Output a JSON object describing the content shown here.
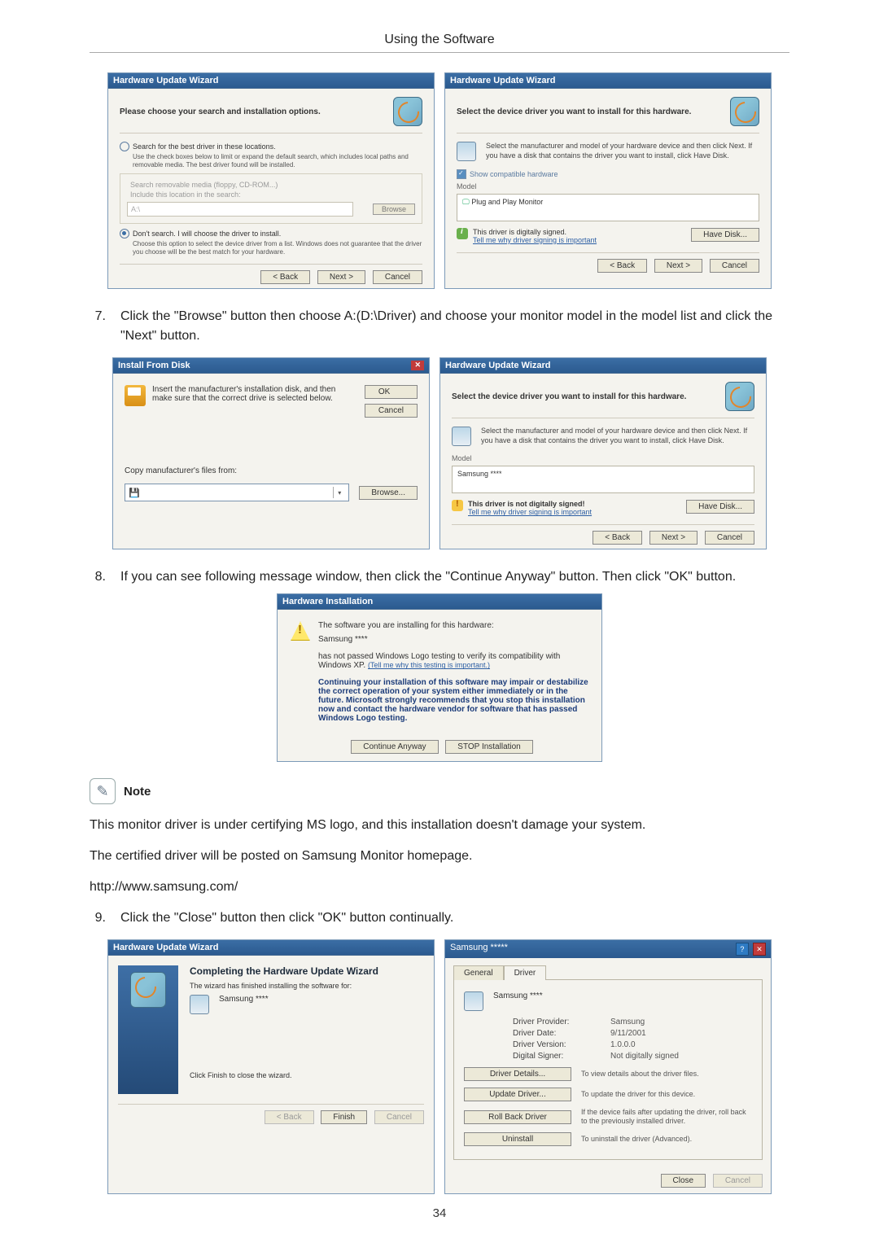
{
  "page_header": "Using the Software",
  "page_number": "34",
  "dialog1": {
    "title": "Hardware Update Wizard",
    "head": "Please choose your search and installation options.",
    "radio1": "Search for the best driver in these locations.",
    "radio1_sub": "Use the check boxes below to limit or expand the default search, which includes local paths and removable media. The best driver found will be installed.",
    "chk1": "Search removable media (floppy, CD-ROM...)",
    "chk2": "Include this location in the search:",
    "path_placeholder": "A:\\",
    "browse": "Browse",
    "radio2": "Don't search. I will choose the driver to install.",
    "radio2_sub": "Choose this option to select the device driver from a list. Windows does not guarantee that the driver you choose will be the best match for your hardware.",
    "back": "< Back",
    "next": "Next >",
    "cancel": "Cancel"
  },
  "dialog2": {
    "title": "Hardware Update Wizard",
    "head": "Select the device driver you want to install for this hardware.",
    "helper": "Select the manufacturer and model of your hardware device and then click Next. If you have a disk that contains the driver you want to install, click Have Disk.",
    "chk": "Show compatible hardware",
    "model_header": "Model",
    "model_value": "Plug and Play Monitor",
    "signed": "This driver is digitally signed.",
    "tell_me": "Tell me why driver signing is important",
    "have_disk": "Have Disk...",
    "back": "< Back",
    "next": "Next >",
    "cancel": "Cancel"
  },
  "step7": {
    "num": "7.",
    "text": "Click the \"Browse\" button then choose A:(D:\\Driver) and choose your monitor model in the model list and click the \"Next\" button."
  },
  "install_disk": {
    "title": "Install From Disk",
    "text": "Insert the manufacturer's installation disk, and then make sure that the correct drive is selected below.",
    "ok": "OK",
    "cancel": "Cancel",
    "copy_label": "Copy manufacturer's files from:",
    "browse": "Browse..."
  },
  "dialog2b": {
    "title": "Hardware Update Wizard",
    "head": "Select the device driver you want to install for this hardware.",
    "helper": "Select the manufacturer and model of your hardware device and then click Next. If you have a disk that contains the driver you want to install, click Have Disk.",
    "model_header": "Model",
    "model_value": "Samsung ****",
    "not_signed": "This driver is not digitally signed!",
    "tell_me": "Tell me why driver signing is important",
    "have_disk": "Have Disk...",
    "back": "< Back",
    "next": "Next >",
    "cancel": "Cancel"
  },
  "step8": {
    "num": "8.",
    "text": "If you can see following message window, then click the \"Continue Anyway\" button. Then click \"OK\" button."
  },
  "hw_install": {
    "title": "Hardware Installation",
    "line1": "The software you are installing for this hardware:",
    "device": "Samsung ****",
    "line2": "has not passed Windows Logo testing to verify its compatibility with Windows XP.",
    "tell_me": "(Tell me why this testing is important.)",
    "bold": "Continuing your installation of this software may impair or destabilize the correct operation of your system either immediately or in the future. Microsoft strongly recommends that you stop this installation now and contact the hardware vendor for software that has passed Windows Logo testing.",
    "continue": "Continue Anyway",
    "stop": "STOP Installation"
  },
  "note_label": "Note",
  "note_p1": "This monitor driver is under certifying MS logo, and this installation doesn't damage your system.",
  "note_p2": "The certified driver will be posted on Samsung Monitor homepage.",
  "note_url": "http://www.samsung.com/",
  "step9": {
    "num": "9.",
    "text": "Click the \"Close\" button then click \"OK\" button continually."
  },
  "complete": {
    "title": "Hardware Update Wizard",
    "head": "Completing the Hardware Update Wizard",
    "sub": "The wizard has finished installing the software for:",
    "device": "Samsung ****",
    "finish_note": "Click Finish to close the wizard.",
    "back": "< Back",
    "finish": "Finish",
    "cancel": "Cancel"
  },
  "props": {
    "title": "Samsung *****",
    "tab_general": "General",
    "tab_driver": "Driver",
    "device": "Samsung ****",
    "provider_k": "Driver Provider:",
    "provider_v": "Samsung",
    "date_k": "Driver Date:",
    "date_v": "9/11/2001",
    "version_k": "Driver Version:",
    "version_v": "1.0.0.0",
    "signer_k": "Digital Signer:",
    "signer_v": "Not digitally signed",
    "btn_details": "Driver Details...",
    "desc_details": "To view details about the driver files.",
    "btn_update": "Update Driver...",
    "desc_update": "To update the driver for this device.",
    "btn_rollback": "Roll Back Driver",
    "desc_rollback": "If the device fails after updating the driver, roll back to the previously installed driver.",
    "btn_uninstall": "Uninstall",
    "desc_uninstall": "To uninstall the driver (Advanced).",
    "close": "Close",
    "cancel": "Cancel"
  }
}
